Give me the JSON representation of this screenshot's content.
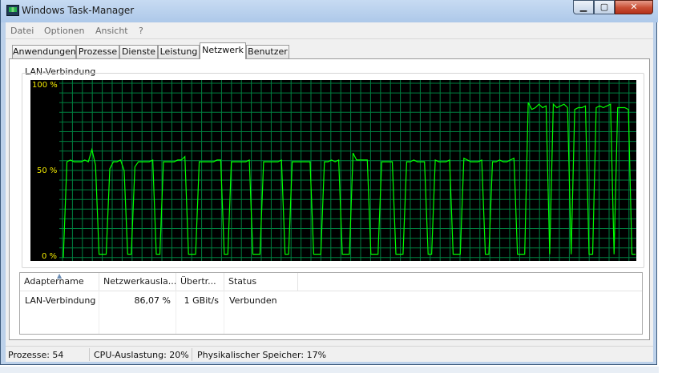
{
  "window": {
    "title": "Windows Task-Manager",
    "minimize": "▁",
    "maximize": "▢",
    "close": "✕"
  },
  "menu": [
    "Datei",
    "Optionen",
    "Ansicht",
    "?"
  ],
  "tabs": [
    "Anwendungen",
    "Prozesse",
    "Dienste",
    "Leistung",
    "Netzwerk",
    "Benutzer"
  ],
  "active_tab": "Netzwerk",
  "graph": {
    "title": "LAN-Verbindung",
    "y_labels": [
      "100 %",
      "50 %",
      "0 %"
    ],
    "colors": {
      "background": "#000000",
      "grid": "#008040",
      "line": "#00ff00",
      "axis_text": "#f2ea00"
    }
  },
  "table": {
    "columns": [
      "Adaptername",
      "Netzwerkausla...",
      "Übertr...",
      "Status"
    ],
    "rows": [
      {
        "name": "LAN-Verbindung",
        "usage": "86,07 %",
        "speed": "1 GBit/s",
        "status": "Verbunden"
      }
    ]
  },
  "statusbar": {
    "processes": "Prozesse: 54",
    "cpu": "CPU-Auslastung: 20%",
    "memory": "Physikalischer Speicher: 17%"
  },
  "chart_data": {
    "type": "line",
    "title": "LAN-Verbindung",
    "xlabel": "",
    "ylabel": "",
    "ylim": [
      0,
      100
    ],
    "grid": true,
    "series": [
      {
        "name": "LAN-Verbindung",
        "values": [
          0,
          55,
          56,
          55,
          55,
          55,
          56,
          55,
          62,
          53,
          2,
          2,
          2,
          51,
          55,
          55,
          56,
          50,
          2,
          2,
          52,
          55,
          55,
          55,
          55,
          56,
          2,
          2,
          55,
          55,
          55,
          55,
          56,
          56,
          58,
          2,
          2,
          2,
          55,
          55,
          55,
          55,
          55,
          56,
          56,
          2,
          2,
          55,
          55,
          55,
          55,
          55,
          56,
          2,
          2,
          2,
          55,
          55,
          55,
          55,
          55,
          56,
          2,
          2,
          55,
          55,
          55,
          55,
          55,
          55,
          2,
          2,
          2,
          55,
          55,
          56,
          55,
          56,
          2,
          2,
          2,
          60,
          56,
          56,
          56,
          56,
          2,
          2,
          2,
          55,
          55,
          55,
          55,
          2,
          2,
          2,
          55,
          55,
          56,
          55,
          55,
          55,
          2,
          2,
          56,
          55,
          55,
          55,
          56,
          2,
          2,
          2,
          57,
          56,
          55,
          55,
          55,
          56,
          2,
          2,
          55,
          55,
          56,
          55,
          55,
          56,
          57,
          2,
          2,
          2,
          89,
          85,
          86,
          88,
          86,
          87,
          2,
          88,
          86,
          87,
          88,
          86,
          2,
          85,
          86,
          86,
          87,
          2,
          2,
          86,
          87,
          86,
          87,
          88,
          2,
          86,
          86,
          86,
          85,
          2,
          2
        ]
      }
    ]
  }
}
